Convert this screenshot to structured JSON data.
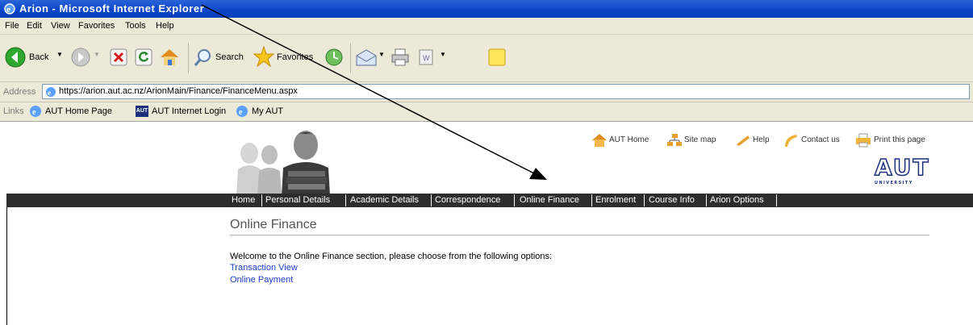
{
  "window": {
    "title": "Arion - Microsoft Internet Explorer"
  },
  "menu": {
    "items": [
      "File",
      "Edit",
      "View",
      "Favorites",
      "Tools",
      "Help"
    ]
  },
  "toolbar": {
    "back_label": "Back",
    "search_label": "Search",
    "favorites_label": "Favorites"
  },
  "address": {
    "label": "Address",
    "url": "https://arion.aut.ac.nz/ArionMain/Finance/FinanceMenu.aspx"
  },
  "links": {
    "label": "Links",
    "items": [
      "AUT Home Page",
      "AUT Internet Login",
      "My AUT"
    ],
    "badge": "AUT"
  },
  "site": {
    "top_links": [
      "AUT Home",
      "Site map",
      "Help",
      "Contact us",
      "Print this page"
    ],
    "logo_text": "AUT",
    "logo_subtext": "UNIVERSITY",
    "nav": [
      "Home",
      "Personal Details",
      "Academic Details",
      "Correspondence",
      "Online Finance",
      "Enrolment",
      "Course Info",
      "Arion Options"
    ]
  },
  "page": {
    "heading": "Online Finance",
    "welcome": "Welcome to the Online Finance section, please choose from the following options:",
    "options": [
      "Transaction View",
      "Online Payment"
    ]
  },
  "colors": {
    "titlebar": "#0a45c9",
    "chrome": "#ece9d8",
    "navbar": "#2d2d2d",
    "link": "#1a3dc8"
  }
}
